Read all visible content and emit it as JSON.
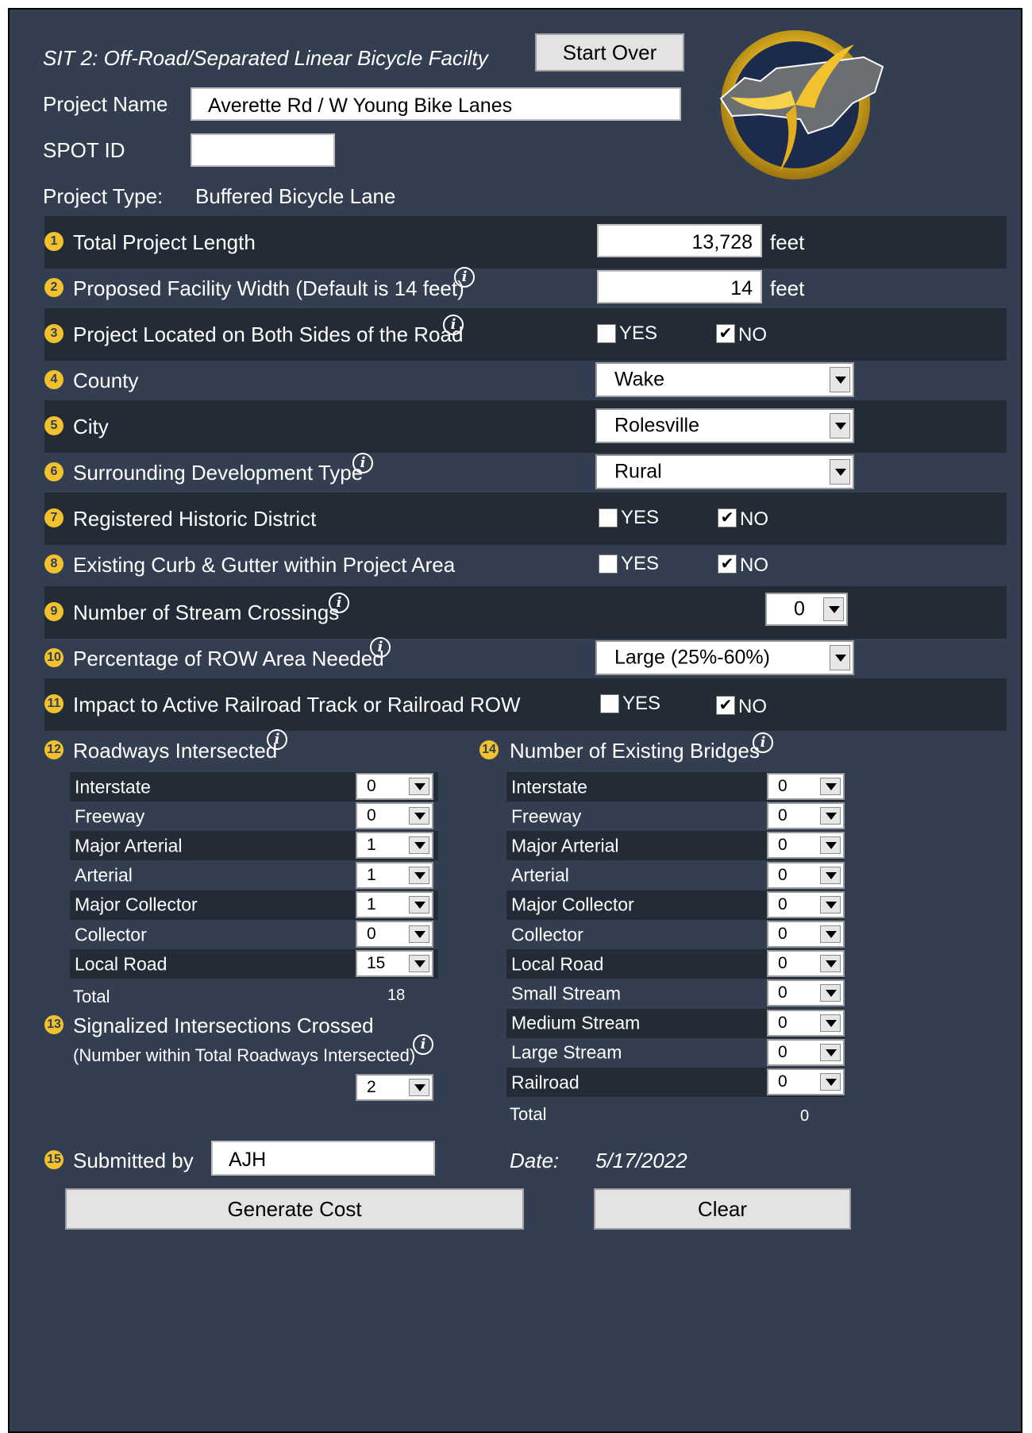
{
  "header": {
    "title": "SIT 2: Off-Road/Separated Linear Bicycle Facilty",
    "start_over": "Start Over",
    "project_name_label": "Project Name",
    "project_name_value": "Averette Rd / W Young Bike Lanes",
    "spot_id_label": "SPOT ID",
    "spot_id_value": "",
    "project_type_label": "Project Type:",
    "project_type_value": "Buffered Bicycle Lane"
  },
  "items": {
    "length": {
      "n": "1",
      "label": "Total Project Length",
      "value": "13,728",
      "unit": "feet"
    },
    "width": {
      "n": "2",
      "label": "Proposed Facility Width (Default is 14 feet)",
      "value": "14",
      "unit": "feet"
    },
    "both_sides": {
      "n": "3",
      "label": "Project Located on Both Sides of the Road",
      "yes": "YES",
      "no": "NO",
      "yes_checked": false,
      "no_checked": true
    },
    "county": {
      "n": "4",
      "label": "County",
      "value": "Wake"
    },
    "city": {
      "n": "5",
      "label": "City",
      "value": "Rolesville"
    },
    "development": {
      "n": "6",
      "label": "Surrounding Development Type",
      "value": "Rural"
    },
    "historic": {
      "n": "7",
      "label": "Registered Historic District",
      "yes": "YES",
      "no": "NO",
      "yes_checked": false,
      "no_checked": true
    },
    "curb": {
      "n": "8",
      "label": "Existing Curb & Gutter within Project Area",
      "yes": "YES",
      "no": "NO",
      "yes_checked": false,
      "no_checked": true
    },
    "streams": {
      "n": "9",
      "label": "Number of Stream Crossings",
      "value": "0"
    },
    "row_area": {
      "n": "10",
      "label": "Percentage of ROW Area Needed",
      "value": "Large (25%-60%)"
    },
    "railroad": {
      "n": "11",
      "label": "Impact to Active Railroad Track or Railroad ROW",
      "yes": "YES",
      "no": "NO",
      "yes_checked": false,
      "no_checked": true
    }
  },
  "roadways": {
    "n": "12",
    "title": "Roadways Intersected",
    "rows": [
      {
        "label": "Interstate",
        "value": "0"
      },
      {
        "label": "Freeway",
        "value": "0"
      },
      {
        "label": "Major Arterial",
        "value": "1"
      },
      {
        "label": "Arterial",
        "value": "1"
      },
      {
        "label": "Major Collector",
        "value": "1"
      },
      {
        "label": "Collector",
        "value": "0"
      },
      {
        "label": "Local Road",
        "value": "15"
      }
    ],
    "total_label": "Total",
    "total_value": "18"
  },
  "signalized": {
    "n": "13",
    "title": "Signalized Intersections Crossed",
    "subtitle": "(Number within Total Roadways Intersected)",
    "value": "2"
  },
  "bridges": {
    "n": "14",
    "title": "Number of Existing Bridges",
    "rows": [
      {
        "label": "Interstate",
        "value": "0"
      },
      {
        "label": "Freeway",
        "value": "0"
      },
      {
        "label": "Major Arterial",
        "value": "0"
      },
      {
        "label": "Arterial",
        "value": "0"
      },
      {
        "label": "Major Collector",
        "value": "0"
      },
      {
        "label": "Collector",
        "value": "0"
      },
      {
        "label": "Local Road",
        "value": "0"
      },
      {
        "label": "Small Stream",
        "value": "0"
      },
      {
        "label": "Medium Stream",
        "value": "0"
      },
      {
        "label": "Large Stream",
        "value": "0"
      },
      {
        "label": "Railroad",
        "value": "0"
      }
    ],
    "total_label": "Total",
    "total_value": "0"
  },
  "footer": {
    "n": "15",
    "submitted_label": "Submitted by",
    "submitted_value": "AJH",
    "date_label": "Date:",
    "date_value": "5/17/2022",
    "generate": "Generate Cost",
    "clear": "Clear"
  },
  "colors": {
    "panel": "#333f50",
    "band": "#222b36",
    "badge": "#f2c12e",
    "logo_ring": "#e8b923",
    "logo_center": "#1c2a4d"
  },
  "logo": {
    "icon": "ncdot-logo"
  }
}
